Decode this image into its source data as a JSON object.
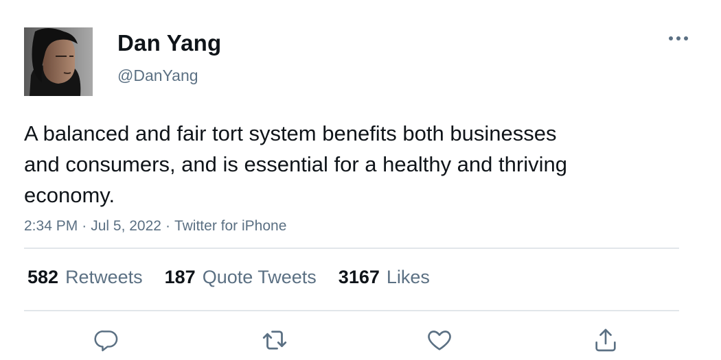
{
  "author": {
    "name": "Dan Yang",
    "handle": "@DanYang"
  },
  "tweet": {
    "text": "A balanced and fair tort system benefits both businesses and consumers, and is essential for a healthy and thriving economy.",
    "time": "2:34 PM",
    "date": "Jul 5, 2022",
    "source": "Twitter for iPhone",
    "separator": "·"
  },
  "stats": {
    "retweets_count": "582",
    "retweets_label": "Retweets",
    "quotes_count": "187",
    "quotes_label": "Quote Tweets",
    "likes_count": "3167",
    "likes_label": "Likes"
  },
  "icons": {
    "more": "more-horizontal-icon",
    "reply": "reply-icon",
    "retweet": "retweet-icon",
    "like": "heart-icon",
    "share": "share-icon"
  },
  "colors": {
    "text_primary": "#0f1419",
    "text_secondary": "#5b7083",
    "divider": "#e1e6ea",
    "icon": "#5b7083"
  }
}
